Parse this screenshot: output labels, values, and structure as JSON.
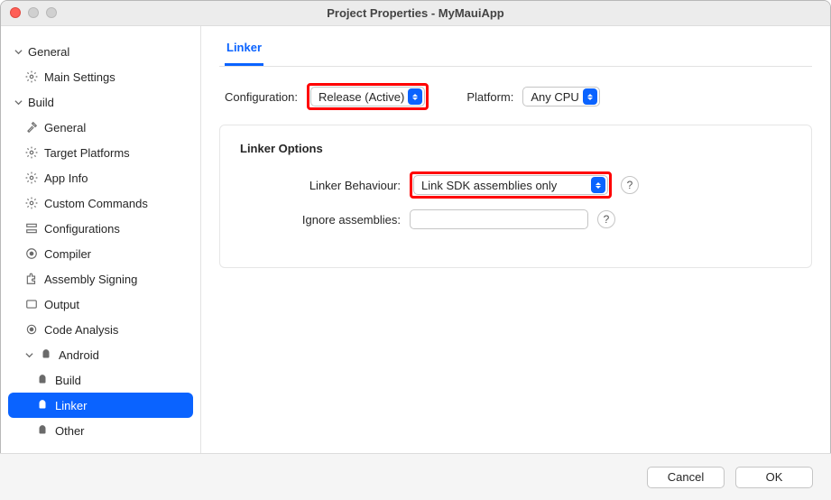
{
  "window": {
    "title": "Project Properties - MyMauiApp"
  },
  "sidebar": {
    "general": {
      "label": "General",
      "items": [
        {
          "label": "Main Settings"
        }
      ]
    },
    "build": {
      "label": "Build",
      "items": [
        {
          "label": "General"
        },
        {
          "label": "Target Platforms"
        },
        {
          "label": "App Info"
        },
        {
          "label": "Custom Commands"
        },
        {
          "label": "Configurations"
        },
        {
          "label": "Compiler"
        },
        {
          "label": "Assembly Signing"
        },
        {
          "label": "Output"
        },
        {
          "label": "Code Analysis"
        }
      ],
      "android": {
        "label": "Android",
        "items": [
          {
            "label": "Build"
          },
          {
            "label": "Linker"
          },
          {
            "label": "Other"
          }
        ]
      }
    }
  },
  "tabs": {
    "active": "Linker"
  },
  "config": {
    "configuration_label": "Configuration:",
    "configuration_value": "Release (Active)",
    "platform_label": "Platform:",
    "platform_value": "Any CPU"
  },
  "linker_options": {
    "title": "Linker Options",
    "behaviour_label": "Linker Behaviour:",
    "behaviour_value": "Link SDK assemblies only",
    "ignore_label": "Ignore assemblies:",
    "ignore_value": ""
  },
  "footer": {
    "cancel": "Cancel",
    "ok": "OK"
  }
}
